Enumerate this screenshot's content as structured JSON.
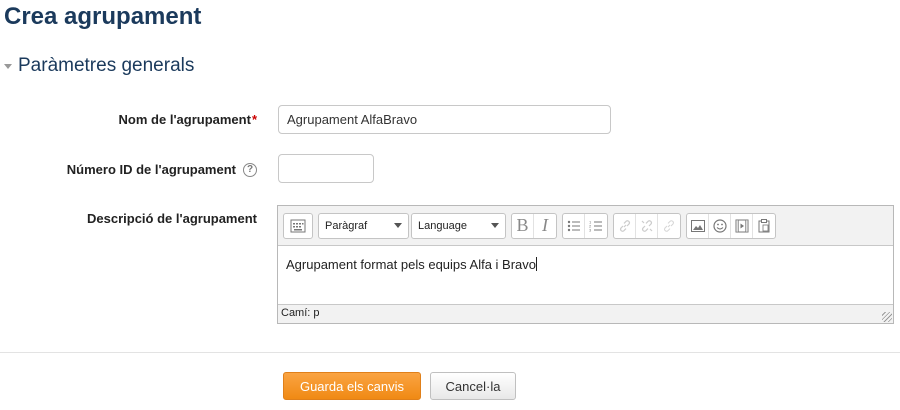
{
  "page": {
    "title": "Crea agrupament",
    "section_title": "Paràmetres generals"
  },
  "form": {
    "name": {
      "label": "Nom de l'agrupament",
      "required_marker": "*",
      "value": "Agrupament AlfaBravo"
    },
    "idnumber": {
      "label": "Número ID de l'agrupament",
      "value": ""
    },
    "description": {
      "label": "Descripció de l'agrupament",
      "format_select": "Paràgraf",
      "language_select": "Language",
      "content": "Agrupament format pels equips Alfa i Bravo",
      "path": "Camí: p"
    }
  },
  "toolbar_icons": [
    "toggle-toolbar-icon",
    "bold-icon",
    "italic-icon",
    "unordered-list-icon",
    "ordered-list-icon",
    "link-icon",
    "unlink-icon",
    "anchor-icon",
    "image-icon",
    "emoticon-icon",
    "media-icon",
    "paste-icon"
  ],
  "buttons": {
    "submit": "Guarda els canvis",
    "cancel": "Cancel·la"
  },
  "colors": {
    "title": "#1b3a5c",
    "primary_button": "#f7941d",
    "required": "#cc0000"
  }
}
